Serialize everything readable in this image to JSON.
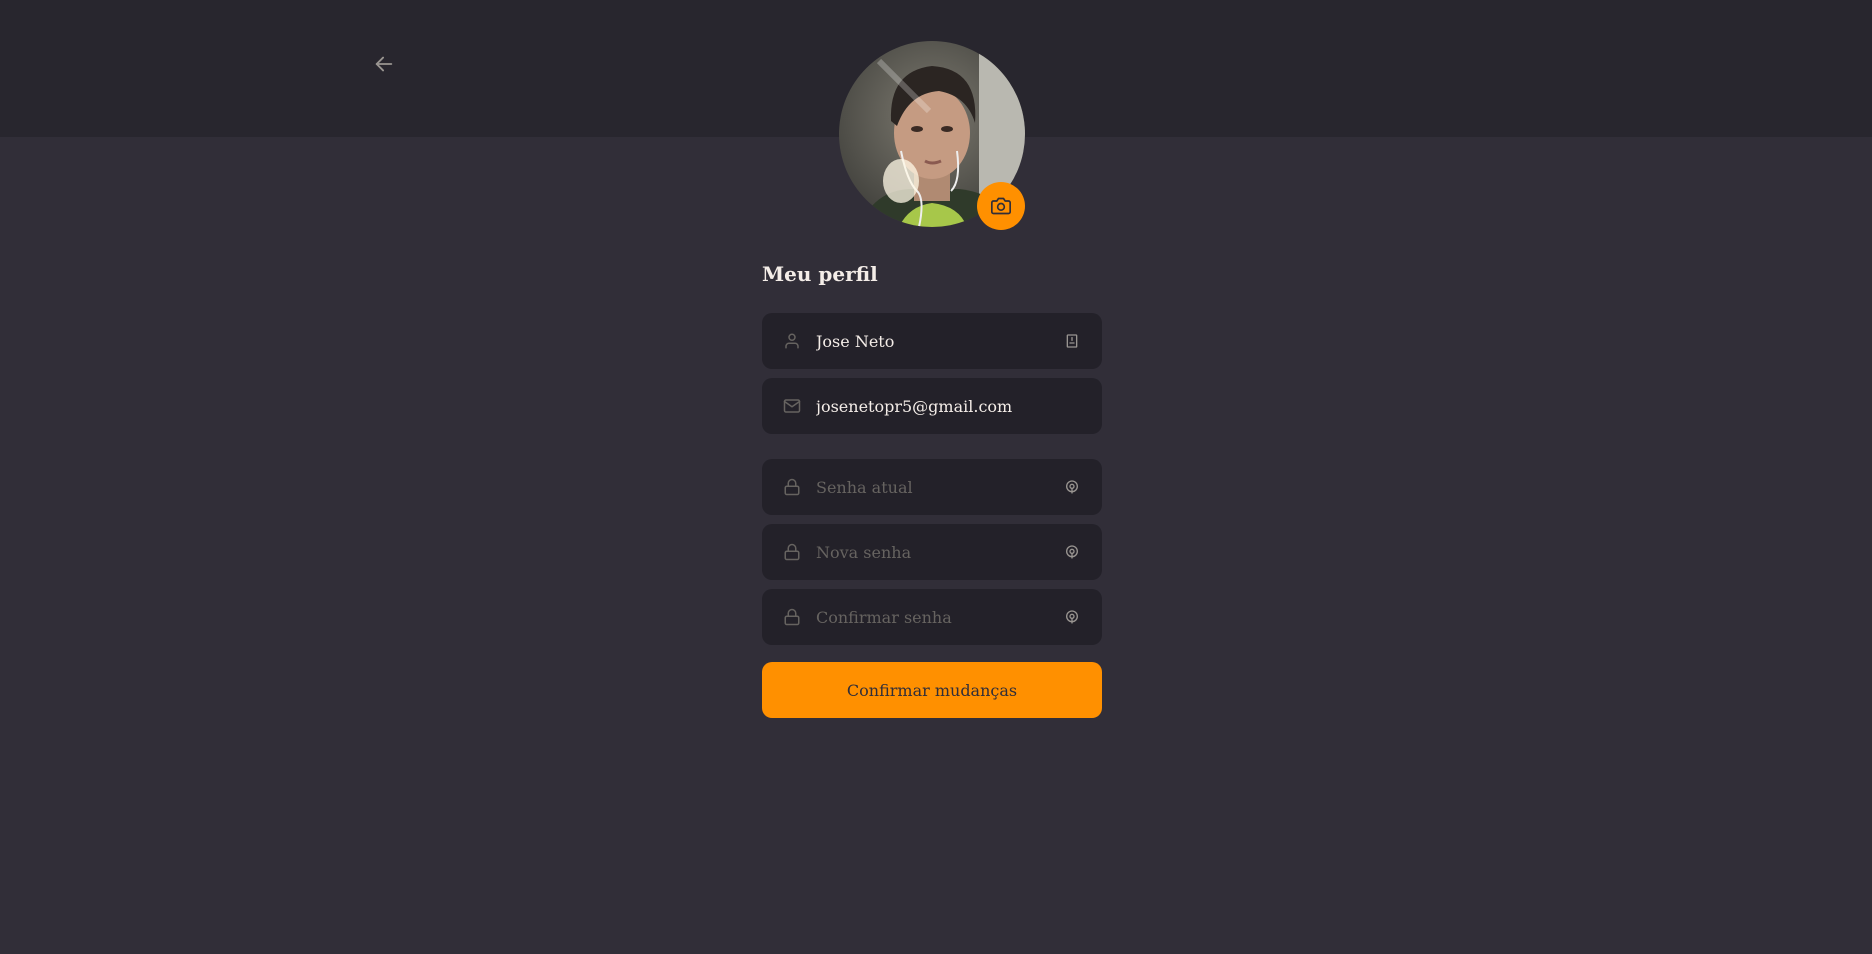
{
  "header": {
    "back_icon": "arrow-left-icon"
  },
  "profile": {
    "avatar_alt": "",
    "camera_icon": "camera-icon",
    "title": "Meu perfil"
  },
  "form": {
    "name": {
      "value": "Jose Neto",
      "icon": "user-icon",
      "trail_icon": "id-card-icon"
    },
    "email": {
      "value": "josenetopr5@gmail.com",
      "icon": "mail-icon"
    },
    "old_password": {
      "placeholder": "Senha atual",
      "icon": "lock-icon",
      "trail_icon": "eye-icon"
    },
    "new_password": {
      "placeholder": "Nova senha",
      "icon": "lock-icon",
      "trail_icon": "eye-icon"
    },
    "confirm_password": {
      "placeholder": "Confirmar senha",
      "icon": "lock-icon",
      "trail_icon": "eye-icon"
    },
    "submit_label": "Confirmar mudanças"
  },
  "colors": {
    "background": "#312e38",
    "header": "#28262e",
    "input": "#232129",
    "accent": "#ff9000",
    "text": "#f4ede8",
    "placeholder": "#666360"
  }
}
